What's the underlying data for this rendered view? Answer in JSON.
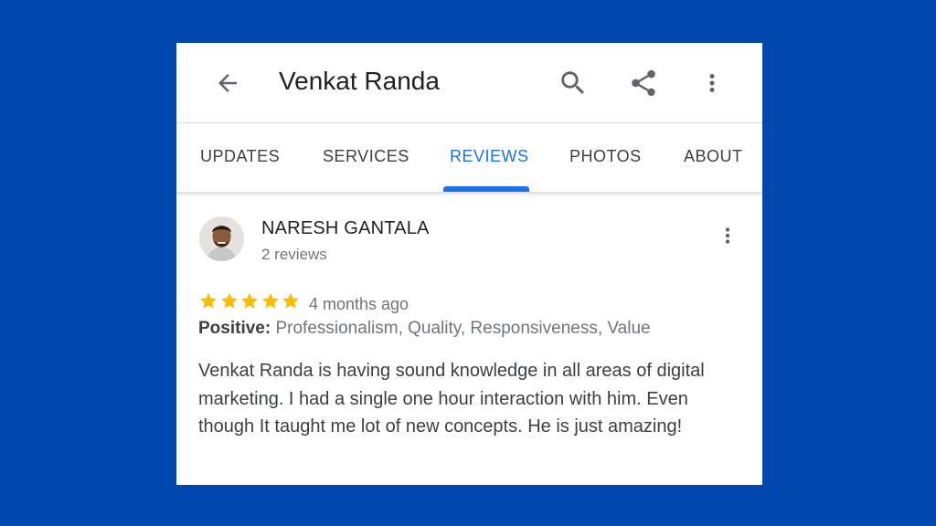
{
  "header": {
    "title": "Venkat Randa",
    "back_icon": "arrow-back-icon",
    "search_icon": "search-icon",
    "share_icon": "share-icon",
    "more_icon": "more-vert-icon"
  },
  "tabs": [
    {
      "label": "UPDATES",
      "active": false
    },
    {
      "label": "SERVICES",
      "active": false
    },
    {
      "label": "REVIEWS",
      "active": true
    },
    {
      "label": "PHOTOS",
      "active": false
    },
    {
      "label": "ABOUT",
      "active": false
    }
  ],
  "review": {
    "reviewer_name": "NARESH GANTALA",
    "review_count": "2 reviews",
    "rating": 5,
    "rating_max": 5,
    "time_ago": "4 months ago",
    "positive_label": "Positive:",
    "positive_values": "Professionalism, Quality, Responsiveness, Value",
    "text": "Venkat Randa is having sound knowledge in all areas of digital marketing. I had a single one hour interaction with him. Even though It taught me lot of new concepts. He is just amazing!"
  },
  "colors": {
    "background": "#0047b0",
    "accent": "#1a73e8",
    "star": "#fbbc04"
  }
}
